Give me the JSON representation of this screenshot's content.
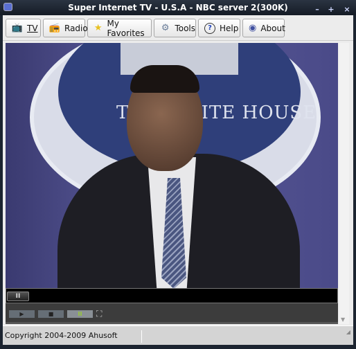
{
  "window": {
    "title": "Super Internet TV - U.S.A - NBC server 2(300K)",
    "minimize": "–",
    "maximize": "+",
    "close": "×"
  },
  "toolbar": {
    "buttons": [
      {
        "label": "TV",
        "icon": "tv-icon"
      },
      {
        "label": "Radio",
        "icon": "radio-icon"
      },
      {
        "label": "My Favorites",
        "icon": "star-icon"
      },
      {
        "label": "Tools",
        "icon": "gear-icon"
      },
      {
        "label": "Help",
        "icon": "help-icon"
      },
      {
        "label": "About",
        "icon": "about-icon"
      }
    ]
  },
  "video": {
    "backdrop_text": "THE WHITE HOUSE",
    "state": "playing"
  },
  "controls": {
    "pause": "II",
    "play": "▶",
    "stop": "■",
    "pause_small": "II",
    "fullscreen": "⛶",
    "active_color": "#9acd32"
  },
  "status": {
    "text": "Copyright 2004-2009 Ahusoft"
  }
}
